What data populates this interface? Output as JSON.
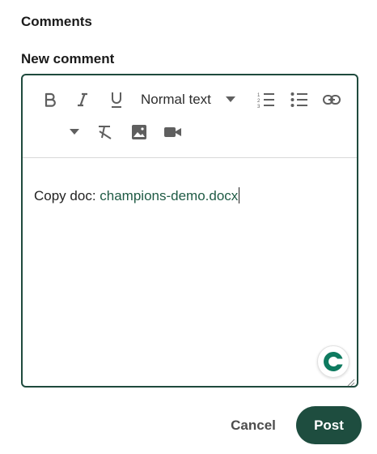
{
  "section": {
    "title": "Comments"
  },
  "form": {
    "label": "New comment",
    "text_style": "Normal text",
    "body_prefix": "Copy doc: ",
    "body_link": "champions-demo.docx",
    "cancel_label": "Cancel",
    "post_label": "Post"
  },
  "toolbar_icons": [
    "bold-icon",
    "italic-icon",
    "underline-icon",
    "text-style-dropdown",
    "numbered-list-icon",
    "bulleted-list-icon",
    "link-icon",
    "more-dropdown",
    "clear-formatting-icon",
    "image-icon",
    "video-icon"
  ],
  "colors": {
    "accent": "#1e4d3f",
    "link": "#1f5b45",
    "border": "#1f4a3d"
  }
}
